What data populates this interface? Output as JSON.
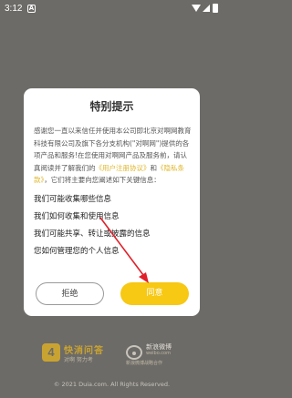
{
  "status_bar": {
    "time": "3:12",
    "notification_glyph": "A"
  },
  "dialog": {
    "title": "特别提示",
    "intro_part1": "感谢您一直以来信任并使用本公司即北京对啊网教育科技有限公司及旗下各分支机构(\"对啊网\")提供的各项产品和服务!在您使用对啊网产品及服务前，请认真阅读并了解我们的",
    "user_agreement_link": "《用户注册协议》",
    "and_text": "和",
    "privacy_link": "《隐私条款》",
    "intro_part2": "，它们将主要向您阐述如下关键信息：",
    "headings": [
      "我们可能收集哪些信息",
      "我们如何收集和使用信息",
      "我们可能共享、转让或披露的信息",
      "您如何管理您的个人信息"
    ],
    "reject_label": "拒绝",
    "agree_label": "同意"
  },
  "background": {
    "brand_left_glyph": "4",
    "brand_left_title": "快消问答",
    "brand_left_sub": "对啊   努力考",
    "brand_right_title": "新浪微博",
    "brand_right_sub": "weibo.com",
    "brand_right_sub2": "新浪微博战略合作",
    "copyright": "© 2021 Duia.com. All Rights Reserved."
  },
  "colors": {
    "accent": "#f7c814",
    "link": "#e0b72c",
    "annotation_arrow": "#e0202a"
  }
}
